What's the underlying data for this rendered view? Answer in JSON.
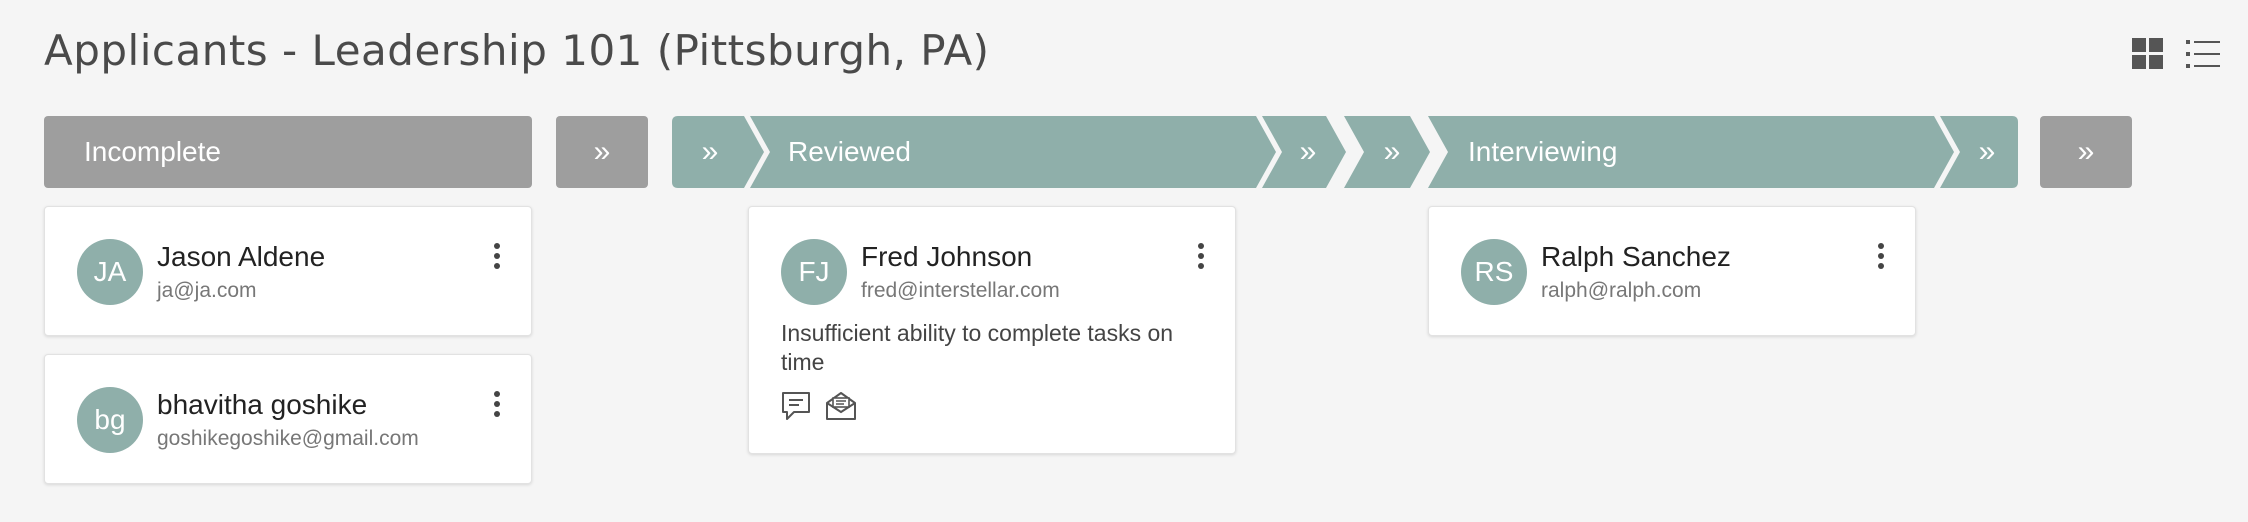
{
  "page": {
    "title": "Applicants - Leadership 101 (Pittsburgh, PA)"
  },
  "view_toggle": {
    "grid": "grid-view-icon",
    "list": "list-view-icon"
  },
  "stages": [
    {
      "label": "Incomplete",
      "style": "gray"
    },
    {
      "label": "Reviewed",
      "style": "teal"
    },
    {
      "label": "Interviewing",
      "style": "teal"
    }
  ],
  "move_symbol": "»",
  "applicants": [
    {
      "initials": "JA",
      "name": "Jason Aldene",
      "email": "ja@ja.com",
      "stage": "Incomplete"
    },
    {
      "initials": "bg",
      "name": "bhavitha goshike",
      "email": "goshikegoshike@gmail.com",
      "stage": "Incomplete"
    },
    {
      "initials": "FJ",
      "name": "Fred Johnson",
      "email": "fred@interstellar.com",
      "stage": "Reviewed",
      "note": "Insufficient ability to complete tasks on time",
      "icons": [
        "comment-icon",
        "email-icon"
      ]
    },
    {
      "initials": "RS",
      "name": "Ralph Sanchez",
      "email": "ralph@ralph.com",
      "stage": "Interviewing"
    }
  ],
  "colors": {
    "teal": "#8fafaa",
    "gray": "#9e9e9e",
    "background": "#f5f5f5"
  }
}
